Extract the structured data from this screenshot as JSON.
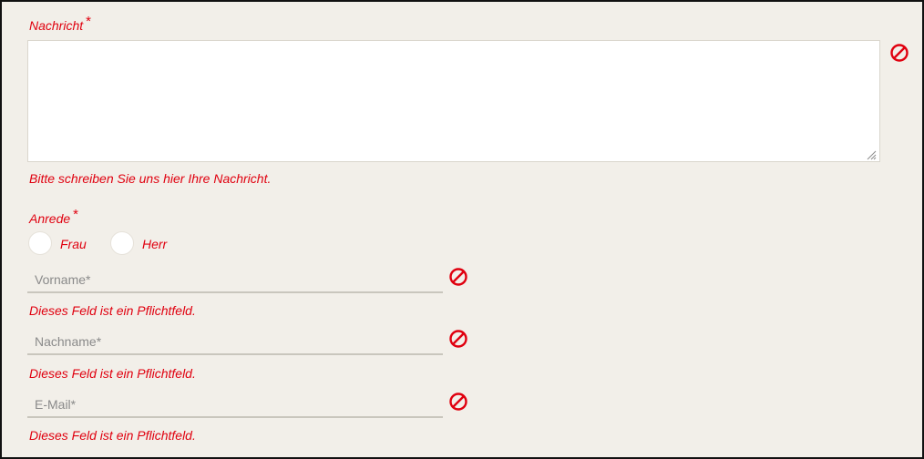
{
  "form": {
    "message": {
      "label": "Nachricht",
      "required_marker": "*",
      "value": "",
      "error": "Bitte schreiben Sie uns hier Ihre Nachricht.",
      "invalid_icon": "prohibited-icon"
    },
    "salutation": {
      "label": "Anrede",
      "required_marker": "*",
      "options": [
        {
          "label": "Frau",
          "checked": false
        },
        {
          "label": "Herr",
          "checked": false
        }
      ]
    },
    "first_name": {
      "placeholder": "Vorname*",
      "value": "",
      "error": "Dieses Feld ist ein Pflichtfeld.",
      "invalid_icon": "prohibited-icon"
    },
    "last_name": {
      "placeholder": "Nachname*",
      "value": "",
      "error": "Dieses Feld ist ein Pflichtfeld.",
      "invalid_icon": "prohibited-icon"
    },
    "email": {
      "placeholder": "E-Mail*",
      "value": "",
      "error": "Dieses Feld ist ein Pflichtfeld.",
      "invalid_icon": "prohibited-icon"
    }
  },
  "colors": {
    "error": "#e0000f",
    "background": "#f2efe9",
    "input_border": "#c9c6bd",
    "frame_border": "#111111"
  }
}
